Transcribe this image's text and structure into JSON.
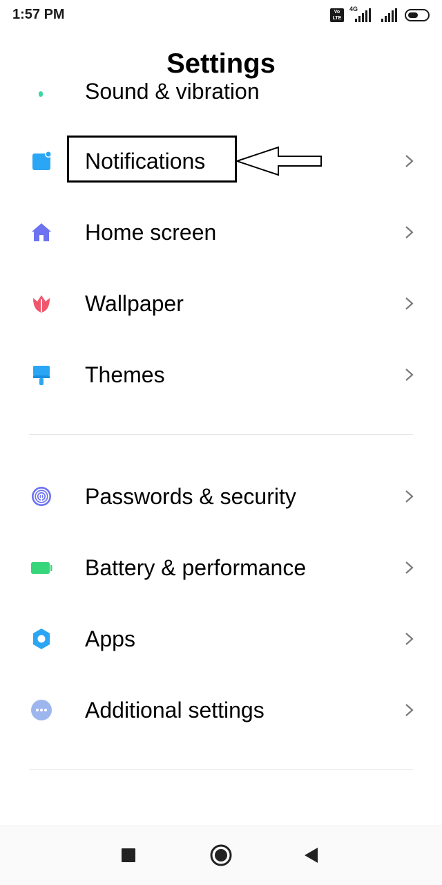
{
  "status_bar": {
    "time": "1:57 PM",
    "volte_line1": "Vo",
    "volte_line2": "LTE",
    "network": "4G"
  },
  "header": {
    "title": "Settings"
  },
  "partial_item": {
    "label": "Sound & vibration"
  },
  "groups": [
    {
      "items": [
        {
          "label": "Notifications",
          "icon": "notifications-icon",
          "color": "#2ba6f5"
        },
        {
          "label": "Home screen",
          "icon": "home-icon",
          "color": "#6c72f0"
        },
        {
          "label": "Wallpaper",
          "icon": "wallpaper-icon",
          "color": "#f0566d"
        },
        {
          "label": "Themes",
          "icon": "themes-icon",
          "color": "#2ba6f5"
        }
      ]
    },
    {
      "items": [
        {
          "label": "Passwords & security",
          "icon": "fingerprint-icon",
          "color": "#6c72f0"
        },
        {
          "label": "Battery & performance",
          "icon": "battery-icon",
          "color": "#38d67a"
        },
        {
          "label": "Apps",
          "icon": "gear-icon",
          "color": "#2ba6f5"
        },
        {
          "label": "Additional settings",
          "icon": "more-icon",
          "color": "#9db6ee"
        }
      ]
    }
  ],
  "nav_bar": {
    "buttons": [
      "recents",
      "home",
      "back"
    ]
  },
  "annotation": {
    "highlighted_item": "Notifications"
  }
}
